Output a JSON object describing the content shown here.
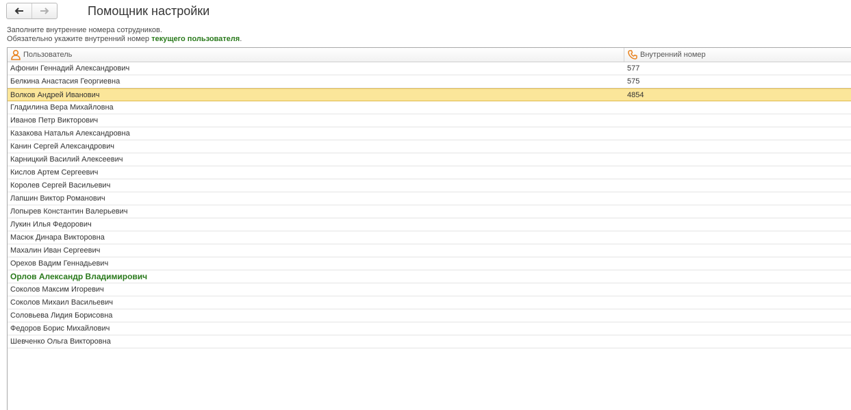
{
  "window": {
    "title": "Помощник настройки"
  },
  "hint": {
    "line1": "Заполните внутренние номера сотрудников.",
    "line2_prefix": "Обязательно укажите внутренний номер ",
    "line2_strong": "текущего пользователя",
    "line2_suffix": "."
  },
  "table": {
    "columns": {
      "user": "Пользователь",
      "number": "Внутренний номер"
    },
    "rows": [
      {
        "name": "Афонин Геннадий Александрович",
        "number": "577"
      },
      {
        "name": "Белкина Анастасия Георгиевна",
        "number": "575"
      },
      {
        "name": "Волков Андрей Иванович",
        "number": "4854"
      },
      {
        "name": "Гладилина Вера Михайловна",
        "number": ""
      },
      {
        "name": "Иванов Петр Викторович",
        "number": ""
      },
      {
        "name": "Казакова Наталья Александровна",
        "number": ""
      },
      {
        "name": "Канин Сергей Александрович",
        "number": ""
      },
      {
        "name": "Карницкий Василий Алексеевич",
        "number": ""
      },
      {
        "name": "Кислов Артем Сергеевич",
        "number": ""
      },
      {
        "name": "Королев Сергей Васильевич",
        "number": ""
      },
      {
        "name": "Лапшин Виктор Романович",
        "number": ""
      },
      {
        "name": "Лопырев Константин Валерьевич",
        "number": ""
      },
      {
        "name": "Лукин Илья Федорович",
        "number": ""
      },
      {
        "name": "Масюк Динара Викторовна",
        "number": ""
      },
      {
        "name": "Махалин Иван Сергеевич",
        "number": ""
      },
      {
        "name": "Орехов Вадим Геннадьевич",
        "number": ""
      },
      {
        "name": "Орлов Александр Владимирович",
        "number": ""
      },
      {
        "name": "Соколов Максим Игоревич",
        "number": ""
      },
      {
        "name": "Соколов Михаил Васильевич",
        "number": ""
      },
      {
        "name": "Соловьева Лидия Борисовна",
        "number": ""
      },
      {
        "name": "Федоров Борис Михайлович",
        "number": ""
      },
      {
        "name": "Шевченко Ольга Викторовна",
        "number": ""
      }
    ]
  },
  "icons": {
    "back": "arrow-left-icon",
    "forward": "arrow-right-icon",
    "user": "user-icon",
    "phone": "phone-icon"
  },
  "colors": {
    "accent_green": "#2a7a1c",
    "selection": "#fbe69a",
    "icon_orange": "#e8821e"
  }
}
